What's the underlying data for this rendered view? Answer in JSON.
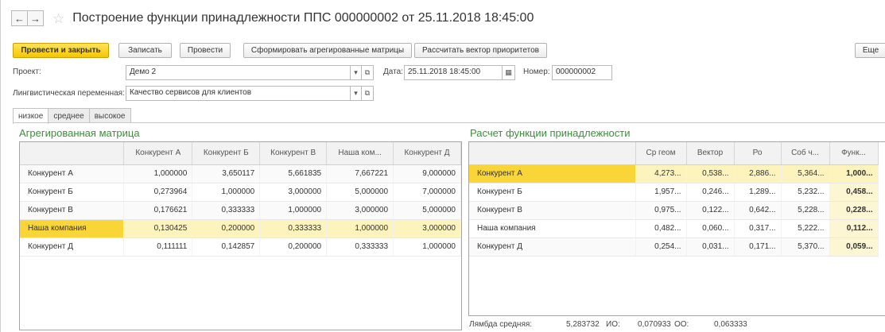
{
  "window": {
    "title": "Построение функции принадлежности ППС 000000002 от 25.11.2018 18:45:00",
    "back_glyph": "←",
    "forward_glyph": "→",
    "favorite_glyph": "☆"
  },
  "toolbar": {
    "post_close": "Провести и закрыть",
    "save": "Записать",
    "post": "Провести",
    "build_matrices": "Сформировать агрегированные матрицы",
    "calc_vector": "Рассчитать вектор приоритетов",
    "more": "Еще"
  },
  "form": {
    "project_label": "Проект:",
    "project_value": "Демо 2",
    "date_label": "Дата:",
    "date_value": "25.11.2018 18:45:00",
    "number_label": "Номер:",
    "number_value": "000000002",
    "ling_label": "Лингвистическая переменная:",
    "ling_value": "Качество сервисов для клиентов",
    "dropdown_glyph": "▾",
    "open_glyph": "⧉",
    "calendar_glyph": "▦"
  },
  "tabs": [
    "низкое",
    "среднее",
    "высокое"
  ],
  "agg_matrix": {
    "title": "Агрегированная матрица",
    "columns": [
      "",
      "Конкурент А",
      "Конкурент Б",
      "Конкурент В",
      "Наша ком...",
      "Конкурент Д"
    ],
    "rows": [
      [
        "Конкурент А",
        "1,000000",
        "3,650117",
        "5,661835",
        "7,667221",
        "9,000000"
      ],
      [
        "Конкурент Б",
        "0,273964",
        "1,000000",
        "3,000000",
        "5,000000",
        "7,000000"
      ],
      [
        "Конкурент В",
        "0,176621",
        "0,333333",
        "1,000000",
        "3,000000",
        "5,000000"
      ],
      [
        "Наша компания",
        "0,130425",
        "0,200000",
        "0,333333",
        "1,000000",
        "3,000000"
      ],
      [
        "Конкурент Д",
        "0,111111",
        "0,142857",
        "0,200000",
        "0,333333",
        "1,000000"
      ]
    ]
  },
  "membership": {
    "title": "Расчет функции принадлежности",
    "columns": [
      "",
      "Ср геом",
      "Вектор",
      "Ро",
      "Соб ч...",
      "Функ..."
    ],
    "rows": [
      [
        "Конкурент А",
        "4,273...",
        "0,538...",
        "2,886...",
        "5,364...",
        "1,000..."
      ],
      [
        "Конкурент Б",
        "1,957...",
        "0,246...",
        "1,289...",
        "5,232...",
        "0,458..."
      ],
      [
        "Конкурент В",
        "0,975...",
        "0,122...",
        "0,642...",
        "5,228...",
        "0,228..."
      ],
      [
        "Наша компания",
        "0,482...",
        "0,060...",
        "0,317...",
        "5,222...",
        "0,112..."
      ],
      [
        "Конкурент Д",
        "0,254...",
        "0,031...",
        "0,171...",
        "5,370...",
        "0,059..."
      ]
    ]
  },
  "footer": {
    "lambda_label": "Лямбда средняя:",
    "lambda_value": "5,283732",
    "io_label": "ИО:",
    "io_value": "0,070933",
    "oo_label": "ОО:",
    "oo_value": "0,063333"
  },
  "colors": {
    "primary_button": "#f5c600",
    "section_title": "#3a8f3a",
    "selected_row": "#fdf3bd",
    "cursor_cell": "#f9d538"
  }
}
